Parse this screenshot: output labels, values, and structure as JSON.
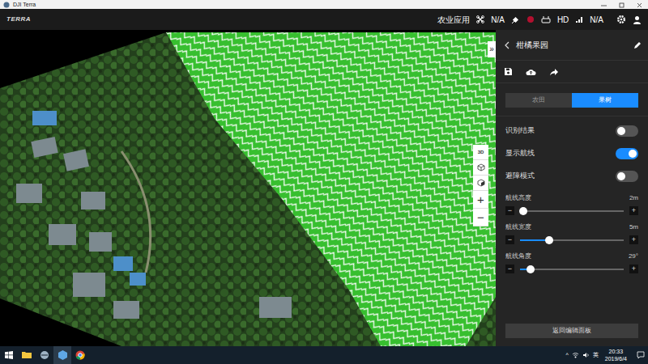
{
  "window": {
    "title": "DJI Terra"
  },
  "topbar": {
    "logo": "TERRA",
    "mode": "农业应用",
    "status": [
      "N/A",
      "HD",
      "N/A"
    ]
  },
  "map": {
    "collapse": "»",
    "tool": "3D",
    "zoom_in": "+",
    "zoom_out": "−"
  },
  "panel": {
    "title": "柑橘果园",
    "segments": [
      {
        "label": "农田",
        "selected": false
      },
      {
        "label": "果树",
        "selected": true
      }
    ],
    "toggles": [
      {
        "label": "识别结果",
        "on": false
      },
      {
        "label": "显示航线",
        "on": true
      },
      {
        "label": "避障模式",
        "on": false
      }
    ],
    "sliders": [
      {
        "label": "航线高度",
        "reading": "2m",
        "level": 0.03
      },
      {
        "label": "航线宽度",
        "reading": "5m",
        "level": 0.28
      },
      {
        "label": "航线角度",
        "reading": "29°",
        "level": 0.1
      }
    ],
    "minus": "−",
    "plus": "+",
    "button": "返回编辑面板"
  },
  "taskbar": {
    "tray_arrow": "^",
    "ime": "英",
    "time": "20:33",
    "date": "2019/6/4"
  }
}
